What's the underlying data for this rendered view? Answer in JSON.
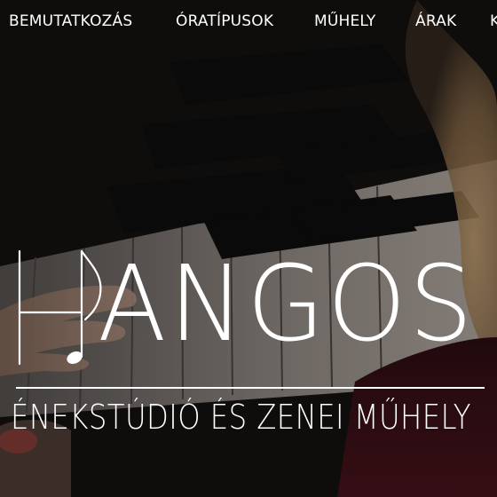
{
  "nav": {
    "items": [
      {
        "label": "BEMUTATKOZÁS"
      },
      {
        "label": "ÓRATÍPUSOK"
      },
      {
        "label": "MŰHELY"
      },
      {
        "label": "ÁRAK"
      },
      {
        "label": "K"
      }
    ]
  },
  "logo": {
    "wordmark": "ANGOS",
    "tagline": "ÉNEKSTÚDIÓ ÉS ZENEI MŰHELY"
  },
  "colors": {
    "text": "#ffffff",
    "accent_nail": "#c8141c"
  },
  "icons": {
    "logo_letter": "h-music-note-icon"
  }
}
